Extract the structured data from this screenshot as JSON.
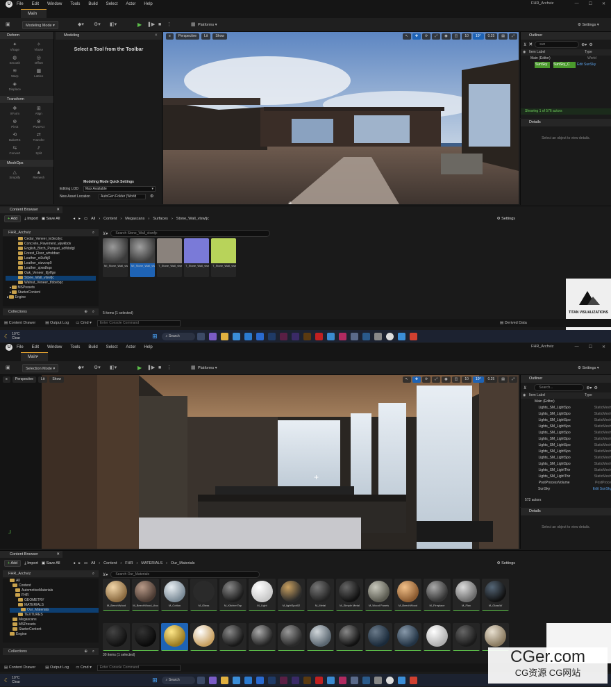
{
  "menu": [
    "File",
    "Edit",
    "Window",
    "Tools",
    "Build",
    "Select",
    "Actor",
    "Help"
  ],
  "project_name": "FHR_Archviz",
  "top": {
    "tab": "Main",
    "mode": "Modeling Mode",
    "platforms": "Platforms",
    "settings": "Settings",
    "modeling": {
      "tab": "Modeling",
      "prompt": "Select a Tool from the Toolbar",
      "sections": [
        {
          "name": "Deform",
          "tools": [
            "Vfrage",
            "Vbuse",
            "Smooth",
            "Offset",
            "Warp",
            "Lattice",
            "Displace"
          ]
        },
        {
          "name": "Transform",
          "tools": [
            "XForm",
            "Align",
            "Pivot",
            "PivotAct",
            "BakeRS",
            "Transfer",
            "Convert",
            "Split"
          ]
        },
        {
          "name": "MeshOps",
          "tools": [
            "Simplify",
            "Remesh"
          ]
        }
      ],
      "quick_settings": "Modeling Mode Quick Settings",
      "editing_lod_label": "Editing LOD",
      "editing_lod_value": "Max Available",
      "asset_loc_label": "New Asset Location",
      "asset_loc_value": "AutoGen Folder (World"
    },
    "viewport": {
      "perspective": "Perspective",
      "lit": "Lit",
      "show": "Show",
      "snap1": "10",
      "snap2": "10°",
      "snap3": "0.25"
    },
    "outliner": {
      "title": "Outliner",
      "search": "sun",
      "col_label": "Item Label",
      "col_type": "Type",
      "rows": [
        {
          "name": "Main (Editor)",
          "type": "World"
        },
        {
          "name": "SunSky",
          "type": "SunSky_C",
          "extra": "Edit SunSky"
        }
      ],
      "status": "Showing 1 of 576 actors"
    },
    "details": {
      "title": "Details",
      "empty": "Select an object to view details."
    },
    "cb": {
      "tab": "Content Browser",
      "add": "Add",
      "import": "Import",
      "save_all": "Save All",
      "settings": "Settings",
      "crumbs": [
        "All",
        "Content",
        "Megascans",
        "Surfaces",
        "Stone_Wall_vlswfjc"
      ],
      "project": "FHR_Archviz",
      "search": "Search Stone_Wall_vlswfjc",
      "tree": [
        "Cedar_Veneer_te3ecdyc",
        "Concrete_Pavement_wjwkbdv",
        "English_Birch_Parquet_udfkbdgl",
        "Forest_Floor_whvbbac",
        "Leather_oi3ufbj0",
        "Leather_oizvcnp0",
        "Leather_sjxedhqo",
        "Oak_Veneer_tfjyffge",
        "Stone_Wall_vlswfjc",
        "Walnut_Veneer_tfdoebqc",
        "MSPresets",
        "StarterContent",
        "Engine"
      ],
      "assets": [
        {
          "label": "MI_Stone_Wall_vlswfjc_4K"
        },
        {
          "label": "MI_Stone_Wall_vlswfjc_4K1"
        },
        {
          "label": "T_Stone_Wall_vlswfjc_4K_D"
        },
        {
          "label": "T_Stone_Wall_vlswfjc_4K_N"
        },
        {
          "label": "T_Stone_Wall_vlswfjc_4K_ORDp"
        }
      ],
      "count": "5 items (1 selected)",
      "collections": "Collections"
    },
    "status": {
      "drawer": "Content Drawer",
      "output": "Output Log",
      "cmd": "Cmd",
      "console": "Enter Console Command",
      "derived": "Derived Data"
    },
    "logo": "TITAN VISUALIZATIONS"
  },
  "taskbar": {
    "weather": "10°C",
    "weather_sub": "Clear",
    "search": "Search"
  },
  "bottom": {
    "tab": "Main",
    "mode": "Selection Mode",
    "outliner": {
      "search": "Search...",
      "rows": [
        {
          "name": "Main (Editor)",
          "type": ""
        },
        {
          "name": "Lights_SM_LightSpo",
          "type": "StaticMesh"
        },
        {
          "name": "Lights_SM_LightSpo",
          "type": "StaticMesh"
        },
        {
          "name": "Lights_SM_LightSpo",
          "type": "StaticMesh"
        },
        {
          "name": "Lights_SM_LightSpo",
          "type": "StaticMesh"
        },
        {
          "name": "Lights_SM_LightSpo",
          "type": "StaticMesh"
        },
        {
          "name": "Lights_SM_LightSpo",
          "type": "StaticMesh"
        },
        {
          "name": "Lights_SM_LightSpo",
          "type": "StaticMesh"
        },
        {
          "name": "Lights_SM_LightSpo",
          "type": "StaticMesh"
        },
        {
          "name": "Lights_SM_LightSpo",
          "type": "StaticMesh"
        },
        {
          "name": "Lights_SM_LightSpo",
          "type": "StaticMesh"
        },
        {
          "name": "Lights_SM_LightThir",
          "type": "StaticMesh"
        },
        {
          "name": "Lights_SM_LightThir",
          "type": "StaticMesh"
        },
        {
          "name": "PostProcessVolume",
          "type": "PostProce"
        },
        {
          "name": "SunSky",
          "type": "Edit SunSky"
        }
      ],
      "status": "572 actors"
    },
    "cb": {
      "crumbs": [
        "All",
        "Content",
        "FHR",
        "MATERIALS",
        "Our_Materials"
      ],
      "search": "Search Our_Materials",
      "tree": [
        "All",
        "Content",
        "AutomotiveMaterials",
        "FHR",
        "GEOMETRY",
        "MATERIALS",
        "Our_Materials",
        "TEXTURES",
        "Megascans",
        "MSPresets",
        "StarterContent",
        "Engine"
      ],
      "materials": [
        "M_BeechWood",
        "M_BeechWood_Ano",
        "M_Cotton",
        "M_Glass",
        "M_KitchenTop",
        "M_Light",
        "M_lightSpot02",
        "M_Metal",
        "M_Simple Metal",
        "M_Wood Panels",
        "M_BeechWood",
        "M_Fireplace",
        "M_Flax",
        "M_GlassW"
      ],
      "count": "30 items (1 selected)"
    }
  },
  "watermark": {
    "main": "CGer.com",
    "sub": "CG资源  CG网站"
  }
}
